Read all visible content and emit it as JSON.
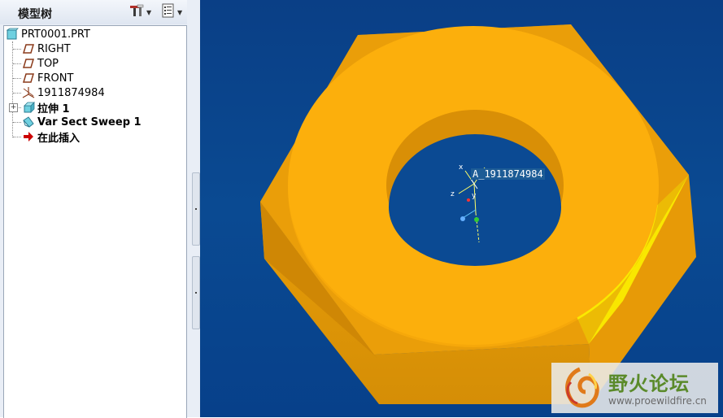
{
  "panel": {
    "title": "模型树"
  },
  "tree": {
    "root": {
      "label": "PRT0001.PRT",
      "icon": "part-icon"
    },
    "items": [
      {
        "label": "RIGHT",
        "icon": "datum-plane-icon"
      },
      {
        "label": "TOP",
        "icon": "datum-plane-icon"
      },
      {
        "label": "FRONT",
        "icon": "datum-plane-icon"
      },
      {
        "label": "1911874984",
        "icon": "coordinate-system-icon"
      },
      {
        "label": "拉伸 1",
        "icon": "extrude-icon"
      },
      {
        "label": "Var Sect Sweep 1",
        "icon": "sweep-icon"
      },
      {
        "label": "在此插入",
        "icon": "insert-here-arrow-icon"
      }
    ]
  },
  "viewport": {
    "csys_label": "A_1911874984",
    "axis_labels": {
      "x": "x",
      "y": "y",
      "z": "z"
    }
  },
  "watermark": {
    "title": "野火论坛",
    "url": "www.proewildfire.cn"
  },
  "colors": {
    "background_top": "#0a3f86",
    "model_face": "#fcae0a",
    "model_side": "#e29a08",
    "model_dark": "#c98405",
    "model_bright": "#fbef00"
  }
}
